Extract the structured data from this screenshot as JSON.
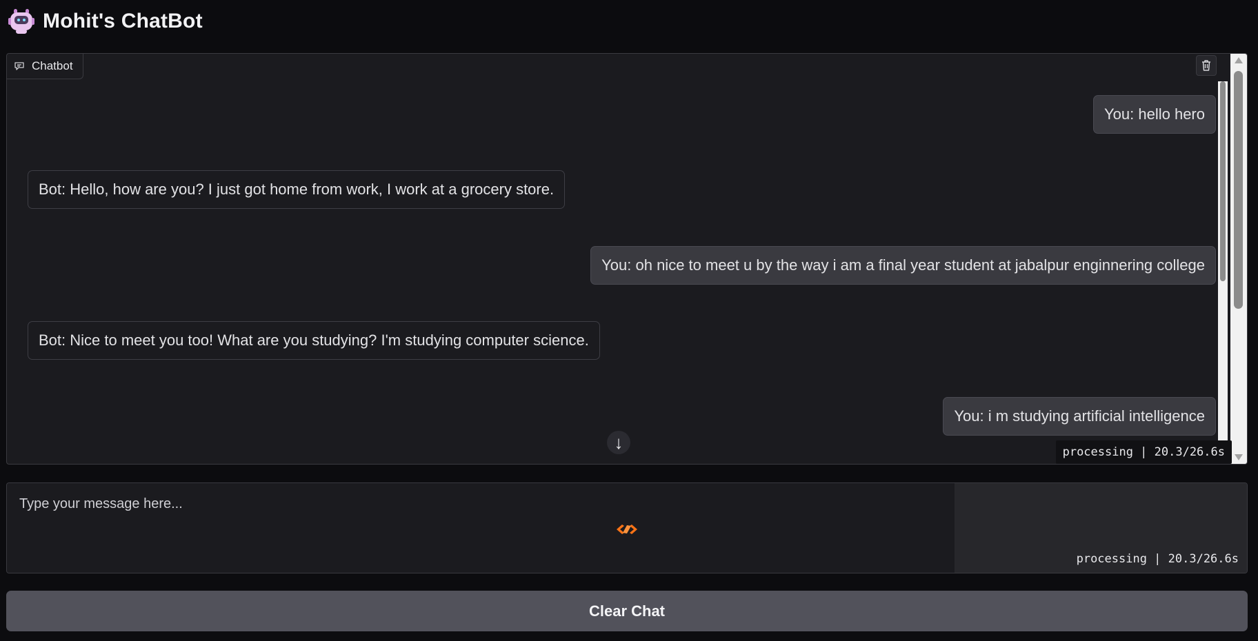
{
  "header": {
    "title": "Mohit's ChatBot",
    "icon": "robot-icon"
  },
  "chatbot": {
    "label": "Chatbot",
    "label_icon": "chat-icon",
    "clear_icon": "trash-icon",
    "messages": [
      {
        "role": "user",
        "text": "You: hello hero"
      },
      {
        "role": "bot",
        "text": "Bot: Hello, how are you? I just got home from work, I work at a grocery store."
      },
      {
        "role": "user",
        "text": "You: oh nice to meet u by the way i am a final year student at jabalpur enginnering college"
      },
      {
        "role": "bot",
        "text": "Bot: Nice to meet you too! What are you studying? I'm studying computer science."
      },
      {
        "role": "user",
        "text": "You: i m studying artificial intelligence"
      }
    ],
    "status": "processing | 20.3/26.6s",
    "scroll_icon": "arrow-down-icon"
  },
  "input": {
    "placeholder": "Type your message here...",
    "status": "processing | 20.3/26.6s",
    "loader_icon": "loading-icon"
  },
  "clear_button": {
    "label": "Clear Chat"
  },
  "colors": {
    "background": "#0c0c0f",
    "panel": "#1b1b1f",
    "user_bubble": "#3a3a40",
    "button": "#52525b",
    "loader": "#f97316"
  }
}
